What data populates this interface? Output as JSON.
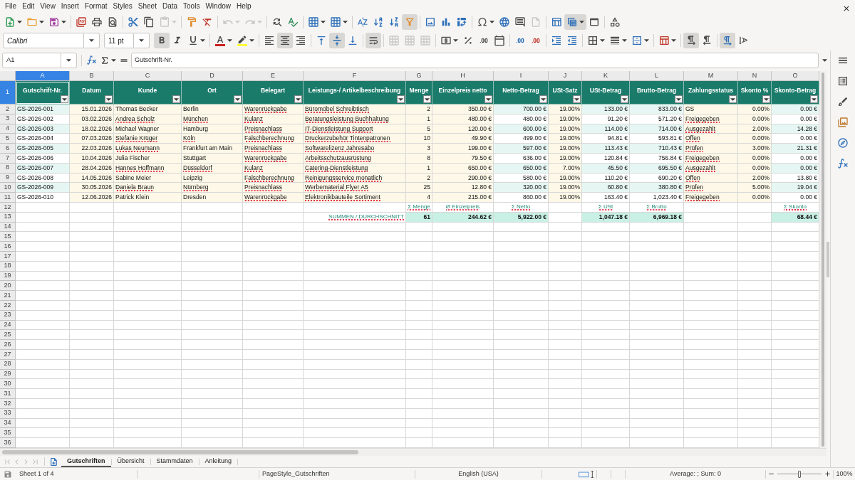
{
  "menu": [
    "File",
    "Edit",
    "View",
    "Insert",
    "Format",
    "Styles",
    "Sheet",
    "Data",
    "Tools",
    "Window",
    "Help"
  ],
  "standard_toolbar": {
    "paste": {
      "disabled": true
    },
    "undo": {
      "disabled": true
    },
    "redo": {
      "disabled": true
    },
    "autofilter": {
      "on": true
    },
    "header_footer": {
      "disabled": true
    },
    "freeze_rows_columns": {
      "on": true
    }
  },
  "formatting_toolbar": {
    "font_name": "Calibri",
    "font_size": "11 pt",
    "bold": {
      "on": true
    },
    "italic": {
      "on": false
    },
    "underline": {
      "on": false
    },
    "align_left": {
      "on": false
    },
    "align_center": {
      "on": true
    },
    "align_right": {
      "on": false
    },
    "align_top": {
      "on": false
    },
    "align_middle": {
      "on": true
    },
    "align_bottom": {
      "on": false
    },
    "wrap_text": {
      "on": true
    },
    "merge_and_center": {
      "disabled": true
    },
    "merge": {
      "disabled": true
    },
    "unmerge": {
      "disabled": true
    },
    "left_to_right": {
      "on": true
    },
    "right_to_left": {
      "on": false
    },
    "text_horizontal": {
      "on": true
    },
    "text_vertical": {
      "on": false
    }
  },
  "formula_bar": {
    "name_box": "A1",
    "content": "Gutschrift-Nr."
  },
  "sheet": {
    "columns": [
      {
        "letter": "A",
        "selected": true,
        "header": "Gutschrift-Nr.",
        "kind": "key"
      },
      {
        "letter": "B",
        "selected": false,
        "header": "Datum",
        "kind": "number"
      },
      {
        "letter": "C",
        "selected": false,
        "header": "Kunde",
        "kind": "text"
      },
      {
        "letter": "D",
        "selected": false,
        "header": "Ort",
        "kind": "text"
      },
      {
        "letter": "E",
        "selected": false,
        "header": "Belegart",
        "kind": "text"
      },
      {
        "letter": "F",
        "selected": false,
        "header": "Leistungs-/ Artikelbeschreibung",
        "kind": "text"
      },
      {
        "letter": "G",
        "selected": false,
        "header": "Menge",
        "kind": "number"
      },
      {
        "letter": "H",
        "selected": false,
        "header": "Einzelpreis netto",
        "kind": "number"
      },
      {
        "letter": "I",
        "selected": false,
        "header": "Netto-Betrag",
        "kind": "calc"
      },
      {
        "letter": "J",
        "selected": false,
        "header": "USt-Satz",
        "kind": "number"
      },
      {
        "letter": "K",
        "selected": false,
        "header": "USt-Betrag",
        "kind": "calc"
      },
      {
        "letter": "L",
        "selected": false,
        "header": "Brutto-Betrag",
        "kind": "calc"
      },
      {
        "letter": "M",
        "selected": false,
        "header": "Zahlungsstatus",
        "kind": "text"
      },
      {
        "letter": "N",
        "selected": false,
        "header": "Skonto %",
        "kind": "number"
      },
      {
        "letter": "O",
        "selected": false,
        "header": "Skonto-Betrag",
        "kind": "calc"
      }
    ],
    "row_numbers": [
      {
        "label": "1",
        "selected": true
      },
      {
        "label": "2",
        "selected": false
      },
      {
        "label": "3",
        "selected": false
      },
      {
        "label": "4",
        "selected": false
      },
      {
        "label": "5",
        "selected": false
      },
      {
        "label": "6",
        "selected": false
      },
      {
        "label": "7",
        "selected": false
      },
      {
        "label": "8",
        "selected": false
      },
      {
        "label": "9",
        "selected": false
      },
      {
        "label": "10",
        "selected": false
      },
      {
        "label": "11",
        "selected": false
      },
      {
        "label": "12",
        "selected": false
      },
      {
        "label": "13",
        "selected": false
      },
      {
        "label": "14",
        "selected": false
      },
      {
        "label": "15",
        "selected": false
      },
      {
        "label": "16",
        "selected": false
      },
      {
        "label": "17",
        "selected": false
      },
      {
        "label": "18",
        "selected": false
      },
      {
        "label": "19",
        "selected": false
      },
      {
        "label": "20",
        "selected": false
      },
      {
        "label": "21",
        "selected": false
      },
      {
        "label": "22",
        "selected": false
      },
      {
        "label": "23",
        "selected": false
      },
      {
        "label": "24",
        "selected": false
      },
      {
        "label": "25",
        "selected": false
      },
      {
        "label": "26",
        "selected": false
      },
      {
        "label": "27",
        "selected": false
      },
      {
        "label": "28",
        "selected": false
      },
      {
        "label": "29",
        "selected": false
      },
      {
        "label": "30",
        "selected": false
      },
      {
        "label": "31",
        "selected": false
      },
      {
        "label": "32",
        "selected": false
      },
      {
        "label": "33",
        "selected": false
      },
      {
        "label": "34",
        "selected": false
      },
      {
        "label": "35",
        "selected": false
      },
      {
        "label": "36",
        "selected": false
      }
    ],
    "rows": [
      {
        "kind": "data",
        "cells": [
          {
            "text": "GS-2026-001",
            "misspelled": false
          },
          {
            "text": "15.01.2026",
            "misspelled": false
          },
          {
            "text": "Thomas Becker",
            "misspelled": false
          },
          {
            "text": "Berlin",
            "misspelled": false
          },
          {
            "text": "Warenrückgabe",
            "misspelled": true
          },
          {
            "text": "Büromöbel Schreibtisch",
            "misspelled": true
          },
          {
            "text": "2",
            "misspelled": false
          },
          {
            "text": "350.00 €",
            "misspelled": false
          },
          {
            "text": "700.00 €",
            "misspelled": false
          },
          {
            "text": "19.00%",
            "misspelled": false
          },
          {
            "text": "133.00 €",
            "misspelled": false
          },
          {
            "text": "833.00 €",
            "misspelled": false
          },
          {
            "text": "GS",
            "misspelled": false
          },
          {
            "text": "0.00%",
            "misspelled": false
          },
          {
            "text": "0.00 €",
            "misspelled": false
          }
        ]
      },
      {
        "kind": "data",
        "cells": [
          {
            "text": "GS-2026-002",
            "misspelled": false
          },
          {
            "text": "03.02.2026",
            "misspelled": false
          },
          {
            "text": "Andrea Scholz",
            "misspelled": true
          },
          {
            "text": "München",
            "misspelled": true
          },
          {
            "text": "Kulanz",
            "misspelled": true
          },
          {
            "text": "Beratungsleistung Buchhaltung",
            "misspelled": true
          },
          {
            "text": "1",
            "misspelled": false
          },
          {
            "text": "480.00 €",
            "misspelled": false
          },
          {
            "text": "480.00 €",
            "misspelled": false
          },
          {
            "text": "19.00%",
            "misspelled": false
          },
          {
            "text": "91.20 €",
            "misspelled": false
          },
          {
            "text": "571.20 €",
            "misspelled": false
          },
          {
            "text": "Freigegeben",
            "misspelled": true
          },
          {
            "text": "0.00%",
            "misspelled": false
          },
          {
            "text": "0.00 €",
            "misspelled": false
          }
        ]
      },
      {
        "kind": "data",
        "cells": [
          {
            "text": "GS-2026-003",
            "misspelled": false
          },
          {
            "text": "18.02.2026",
            "misspelled": false
          },
          {
            "text": "Michael Wagner",
            "misspelled": false
          },
          {
            "text": "Hamburg",
            "misspelled": false
          },
          {
            "text": "Preisnachlass",
            "misspelled": true
          },
          {
            "text": "IT-Dienstleistung Support",
            "misspelled": true
          },
          {
            "text": "5",
            "misspelled": false
          },
          {
            "text": "120.00 €",
            "misspelled": false
          },
          {
            "text": "600.00 €",
            "misspelled": false
          },
          {
            "text": "19.00%",
            "misspelled": false
          },
          {
            "text": "114.00 €",
            "misspelled": false
          },
          {
            "text": "714.00 €",
            "misspelled": false
          },
          {
            "text": "Ausgezahlt",
            "misspelled": true
          },
          {
            "text": "2.00%",
            "misspelled": false
          },
          {
            "text": "14.28 €",
            "misspelled": false
          }
        ]
      },
      {
        "kind": "data",
        "cells": [
          {
            "text": "GS-2026-004",
            "misspelled": false
          },
          {
            "text": "07.03.2026",
            "misspelled": false
          },
          {
            "text": "Stefanie Krüger",
            "misspelled": true
          },
          {
            "text": "Köln",
            "misspelled": true
          },
          {
            "text": "Falschberechnung",
            "misspelled": true
          },
          {
            "text": "Druckerzubehör Tintenpatronen",
            "misspelled": true
          },
          {
            "text": "10",
            "misspelled": false
          },
          {
            "text": "49.90 €",
            "misspelled": false
          },
          {
            "text": "499.00 €",
            "misspelled": false
          },
          {
            "text": "19.00%",
            "misspelled": false
          },
          {
            "text": "94.81 €",
            "misspelled": false
          },
          {
            "text": "593.81 €",
            "misspelled": false
          },
          {
            "text": "Offen",
            "misspelled": true
          },
          {
            "text": "0.00%",
            "misspelled": false
          },
          {
            "text": "0.00 €",
            "misspelled": false
          }
        ]
      },
      {
        "kind": "data",
        "cells": [
          {
            "text": "GS-2026-005",
            "misspelled": false
          },
          {
            "text": "22.03.2026",
            "misspelled": false
          },
          {
            "text": "Lukas Neumann",
            "misspelled": true
          },
          {
            "text": "Frankfurt am Main",
            "misspelled": false
          },
          {
            "text": "Preisnachlass",
            "misspelled": true
          },
          {
            "text": "Softwarelizenz Jahresabo",
            "misspelled": true
          },
          {
            "text": "3",
            "misspelled": false
          },
          {
            "text": "199.00 €",
            "misspelled": false
          },
          {
            "text": "597.00 €",
            "misspelled": false
          },
          {
            "text": "19.00%",
            "misspelled": false
          },
          {
            "text": "113.43 €",
            "misspelled": false
          },
          {
            "text": "710.43 €",
            "misspelled": false
          },
          {
            "text": "Prüfen",
            "misspelled": true
          },
          {
            "text": "3.00%",
            "misspelled": false
          },
          {
            "text": "21.31 €",
            "misspelled": false
          }
        ]
      },
      {
        "kind": "data",
        "cells": [
          {
            "text": "GS-2026-006",
            "misspelled": false
          },
          {
            "text": "10.04.2026",
            "misspelled": false
          },
          {
            "text": "Julia Fischer",
            "misspelled": false
          },
          {
            "text": "Stuttgart",
            "misspelled": false
          },
          {
            "text": "Warenrückgabe",
            "misspelled": true
          },
          {
            "text": "Arbeitsschutzausrüstung",
            "misspelled": true
          },
          {
            "text": "8",
            "misspelled": false
          },
          {
            "text": "79.50 €",
            "misspelled": false
          },
          {
            "text": "636.00 €",
            "misspelled": false
          },
          {
            "text": "19.00%",
            "misspelled": false
          },
          {
            "text": "120.84 €",
            "misspelled": false
          },
          {
            "text": "756.84 €",
            "misspelled": false
          },
          {
            "text": "Freigegeben",
            "misspelled": true
          },
          {
            "text": "0.00%",
            "misspelled": false
          },
          {
            "text": "0.00 €",
            "misspelled": false
          }
        ]
      },
      {
        "kind": "data",
        "cells": [
          {
            "text": "GS-2026-007",
            "misspelled": false
          },
          {
            "text": "28.04.2026",
            "misspelled": false
          },
          {
            "text": "Hannes Hoffmann",
            "misspelled": true
          },
          {
            "text": "Düsseldorf",
            "misspelled": true
          },
          {
            "text": "Kulanz",
            "misspelled": true
          },
          {
            "text": "Catering-Dienstleistung",
            "misspelled": true
          },
          {
            "text": "1",
            "misspelled": false
          },
          {
            "text": "650.00 €",
            "misspelled": false
          },
          {
            "text": "650.00 €",
            "misspelled": false
          },
          {
            "text": "7.00%",
            "misspelled": false
          },
          {
            "text": "45.50 €",
            "misspelled": false
          },
          {
            "text": "695.50 €",
            "misspelled": false
          },
          {
            "text": "Ausgezahlt",
            "misspelled": true
          },
          {
            "text": "0.00%",
            "misspelled": false
          },
          {
            "text": "0.00 €",
            "misspelled": false
          }
        ]
      },
      {
        "kind": "data",
        "cells": [
          {
            "text": "GS-2026-008",
            "misspelled": false
          },
          {
            "text": "14.05.2026",
            "misspelled": false
          },
          {
            "text": "Sabine Meier",
            "misspelled": false
          },
          {
            "text": "Leipzig",
            "misspelled": false
          },
          {
            "text": "Falschberechnung",
            "misspelled": true
          },
          {
            "text": "Reinigungsservice monatlich",
            "misspelled": true
          },
          {
            "text": "2",
            "misspelled": false
          },
          {
            "text": "290.00 €",
            "misspelled": false
          },
          {
            "text": "580.00 €",
            "misspelled": false
          },
          {
            "text": "19.00%",
            "misspelled": false
          },
          {
            "text": "110.20 €",
            "misspelled": false
          },
          {
            "text": "690.20 €",
            "misspelled": false
          },
          {
            "text": "Offen",
            "misspelled": true
          },
          {
            "text": "2.00%",
            "misspelled": false
          },
          {
            "text": "13.80 €",
            "misspelled": false
          }
        ]
      },
      {
        "kind": "data",
        "cells": [
          {
            "text": "GS-2026-009",
            "misspelled": false
          },
          {
            "text": "30.05.2026",
            "misspelled": false
          },
          {
            "text": "Daniela Braun",
            "misspelled": true
          },
          {
            "text": "Nürnberg",
            "misspelled": true
          },
          {
            "text": "Preisnachlass",
            "misspelled": true
          },
          {
            "text": "Werbematerial Flyer A5",
            "misspelled": true
          },
          {
            "text": "25",
            "misspelled": false
          },
          {
            "text": "12.80 €",
            "misspelled": false
          },
          {
            "text": "320.00 €",
            "misspelled": false
          },
          {
            "text": "19.00%",
            "misspelled": false
          },
          {
            "text": "60.80 €",
            "misspelled": false
          },
          {
            "text": "380.80 €",
            "misspelled": false
          },
          {
            "text": "Prüfen",
            "misspelled": true
          },
          {
            "text": "5.00%",
            "misspelled": false
          },
          {
            "text": "19.04 €",
            "misspelled": false
          }
        ]
      },
      {
        "kind": "data",
        "cells": [
          {
            "text": "GS-2026-010",
            "misspelled": false
          },
          {
            "text": "12.06.2026",
            "misspelled": false
          },
          {
            "text": "Patrick Klein",
            "misspelled": false
          },
          {
            "text": "Dresden",
            "misspelled": false
          },
          {
            "text": "Warenrückgabe",
            "misspelled": true
          },
          {
            "text": "Elektronikbauteile Sortiment",
            "misspelled": true
          },
          {
            "text": "4",
            "misspelled": false
          },
          {
            "text": "215.00 €",
            "misspelled": false
          },
          {
            "text": "860.00 €",
            "misspelled": false
          },
          {
            "text": "19.00%",
            "misspelled": false
          },
          {
            "text": "163.40 €",
            "misspelled": false
          },
          {
            "text": "1,023.40 €",
            "misspelled": false
          },
          {
            "text": "Freigegeben",
            "misspelled": true
          },
          {
            "text": "0.00%",
            "misspelled": false
          },
          {
            "text": "0.00 €",
            "misspelled": false
          }
        ]
      },
      {
        "kind": "label",
        "cells": [
          null,
          null,
          null,
          null,
          null,
          null,
          {
            "text": "Σ Menge",
            "misspelled": true
          },
          {
            "text": "Ø Einzelpreis",
            "misspelled": true
          },
          {
            "text": "Σ Netto",
            "misspelled": true
          },
          null,
          {
            "text": "Σ USt",
            "misspelled": true
          },
          {
            "text": "Σ Brutto",
            "misspelled": true
          },
          null,
          null,
          {
            "text": "Σ Skonto",
            "misspelled": true
          }
        ]
      },
      {
        "kind": "total",
        "cells": [
          null,
          null,
          null,
          null,
          null,
          {
            "kind": "caption",
            "text": "SUMMEN / DURCHSCHNITT",
            "misspelled": true
          },
          {
            "kind": "sum",
            "text": "61",
            "misspelled": false
          },
          {
            "kind": "sum",
            "text": "244.62 €",
            "misspelled": false
          },
          {
            "kind": "sum",
            "text": "5,922.00 €",
            "misspelled": false
          },
          null,
          {
            "kind": "sum",
            "text": "1,047.18 €",
            "misspelled": false
          },
          {
            "kind": "sum",
            "text": "6,969.18 €",
            "misspelled": false
          },
          null,
          null,
          {
            "kind": "sum",
            "text": "68.44 €",
            "misspelled": false
          }
        ]
      }
    ]
  },
  "sheet_tabs": [
    {
      "label": "Gutschriften",
      "selected": true
    },
    {
      "label": "Übersicht",
      "selected": false
    },
    {
      "label": "Stammdaten",
      "selected": false
    },
    {
      "label": "Anleitung",
      "selected": false
    }
  ],
  "status_bar": {
    "sheet_position": "Sheet 1 of 4",
    "page_style": "PageStyle_Gutschriften",
    "language": "English (USA)",
    "selection_summary": "Average: ; Sum: 0",
    "zoom": {
      "level": 0.5,
      "reading": "100%"
    }
  }
}
